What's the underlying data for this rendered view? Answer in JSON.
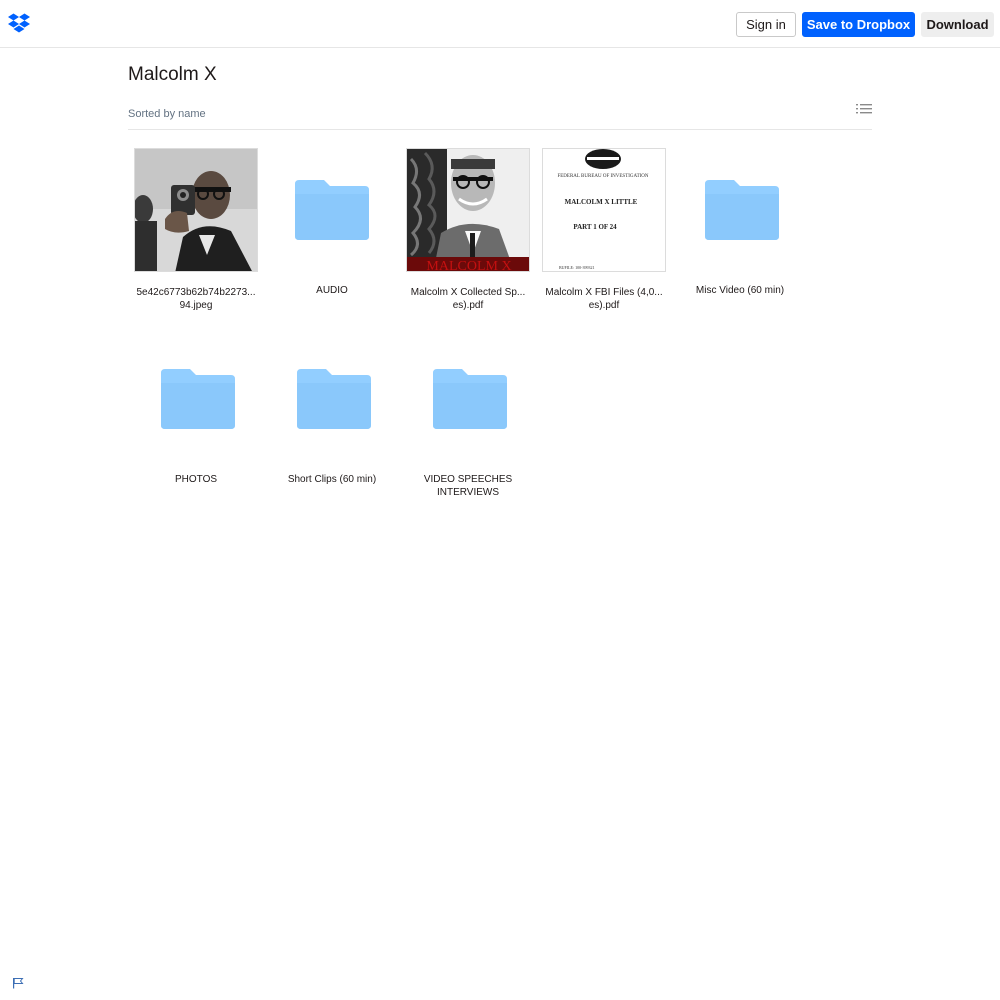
{
  "header": {
    "logo_icon": "dropbox-logo-icon",
    "signin_label": "Sign in",
    "save_label": "Save to Dropbox",
    "download_label": "Download",
    "accent_color": "#0061fe"
  },
  "folder": {
    "title": "Malcolm X",
    "sort_label": "Sorted by name",
    "view_toggle_icon": "list-view-icon"
  },
  "items": [
    {
      "type": "image",
      "line1": "5e42c6773b62b74b2273...",
      "line2": "94.jpeg",
      "icon": "photo-thumbnail"
    },
    {
      "type": "folder",
      "line1": "AUDIO",
      "line2": "",
      "icon": "folder-icon"
    },
    {
      "type": "pdf",
      "line1": "Malcolm X Collected Sp...",
      "line2": "es).pdf",
      "icon": "pdf-thumbnail",
      "thumb_text": "MALCOLM X"
    },
    {
      "type": "pdf",
      "line1": "Malcolm X FBI Files (4,0...",
      "line2": "es).pdf",
      "icon": "pdf-thumbnail",
      "doc_lines": [
        "FEDERAL BUREAU OF INVESTIGATION",
        "MALCOLM X LITTLE",
        "PART 1 OF 24",
        "BUFILE: 100-399321"
      ]
    },
    {
      "type": "folder",
      "line1": "Misc Video (60 min)",
      "line2": "",
      "icon": "folder-icon"
    },
    {
      "type": "folder",
      "line1": "PHOTOS",
      "line2": "",
      "icon": "folder-icon"
    },
    {
      "type": "folder",
      "line1": "Short Clips (60 min)",
      "line2": "",
      "icon": "folder-icon"
    },
    {
      "type": "folder",
      "line1": "VIDEO SPEECHES",
      "line2": "INTERVIEWS",
      "icon": "folder-icon"
    }
  ],
  "footer": {
    "flag_icon": "flag-icon"
  },
  "folder_color": "#92ceff"
}
